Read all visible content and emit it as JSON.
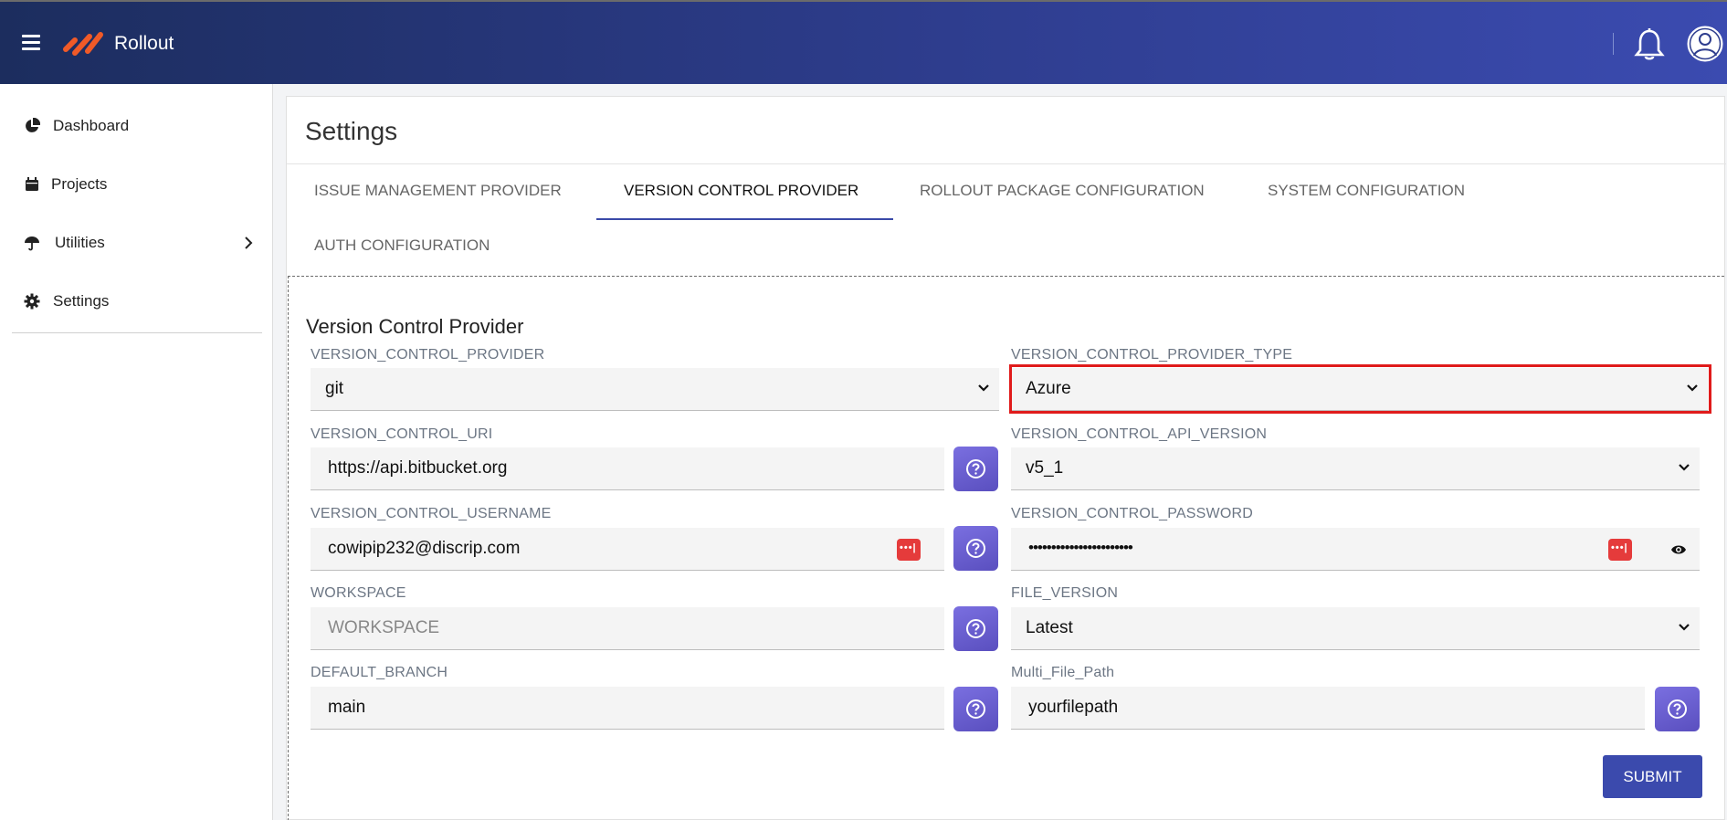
{
  "app": {
    "brand": "Rollout"
  },
  "sidebar": {
    "items": [
      {
        "label": "Dashboard",
        "icon": "pie-chart-icon"
      },
      {
        "label": "Projects",
        "icon": "calendar-icon"
      },
      {
        "label": "Utilities",
        "icon": "umbrella-icon",
        "has_submenu": true
      },
      {
        "label": "Settings",
        "icon": "gear-icon"
      }
    ]
  },
  "page": {
    "title": "Settings"
  },
  "tabs": [
    {
      "label": "ISSUE MANAGEMENT PROVIDER",
      "active": false
    },
    {
      "label": "VERSION CONTROL PROVIDER",
      "active": true
    },
    {
      "label": "ROLLOUT PACKAGE CONFIGURATION",
      "active": false
    },
    {
      "label": "SYSTEM CONFIGURATION",
      "active": false
    },
    {
      "label": "AUTH CONFIGURATION",
      "active": false
    }
  ],
  "form": {
    "section_title": "Version Control Provider",
    "provider": {
      "label": "VERSION_CONTROL_PROVIDER",
      "value": "git"
    },
    "provider_type": {
      "label": "VERSION_CONTROL_PROVIDER_TYPE",
      "value": "Azure"
    },
    "uri": {
      "label": "VERSION_CONTROL_URI",
      "value": "https://api.bitbucket.org"
    },
    "api_version": {
      "label": "VERSION_CONTROL_API_VERSION",
      "value": "v5_1"
    },
    "username": {
      "label": "VERSION_CONTROL_USERNAME",
      "value": "cowipip232@discrip.com"
    },
    "password": {
      "label": "VERSION_CONTROL_PASSWORD",
      "value": "•••••••••••••••••••••••"
    },
    "workspace": {
      "label": "WORKSPACE",
      "placeholder": "WORKSPACE"
    },
    "file_version": {
      "label": "FILE_VERSION",
      "value": "Latest"
    },
    "default_branch": {
      "label": "DEFAULT_BRANCH",
      "value": "main"
    },
    "multi_file_path": {
      "label": "Multi_File_Path",
      "value": "yourfilepath"
    },
    "submit_label": "SUBMIT"
  },
  "colors": {
    "header_start": "#1c2d5e",
    "header_end": "#3b4bb0",
    "accent": "#3b4aad",
    "highlight": "#e01b1b",
    "help_button": "#6a5fd0"
  }
}
